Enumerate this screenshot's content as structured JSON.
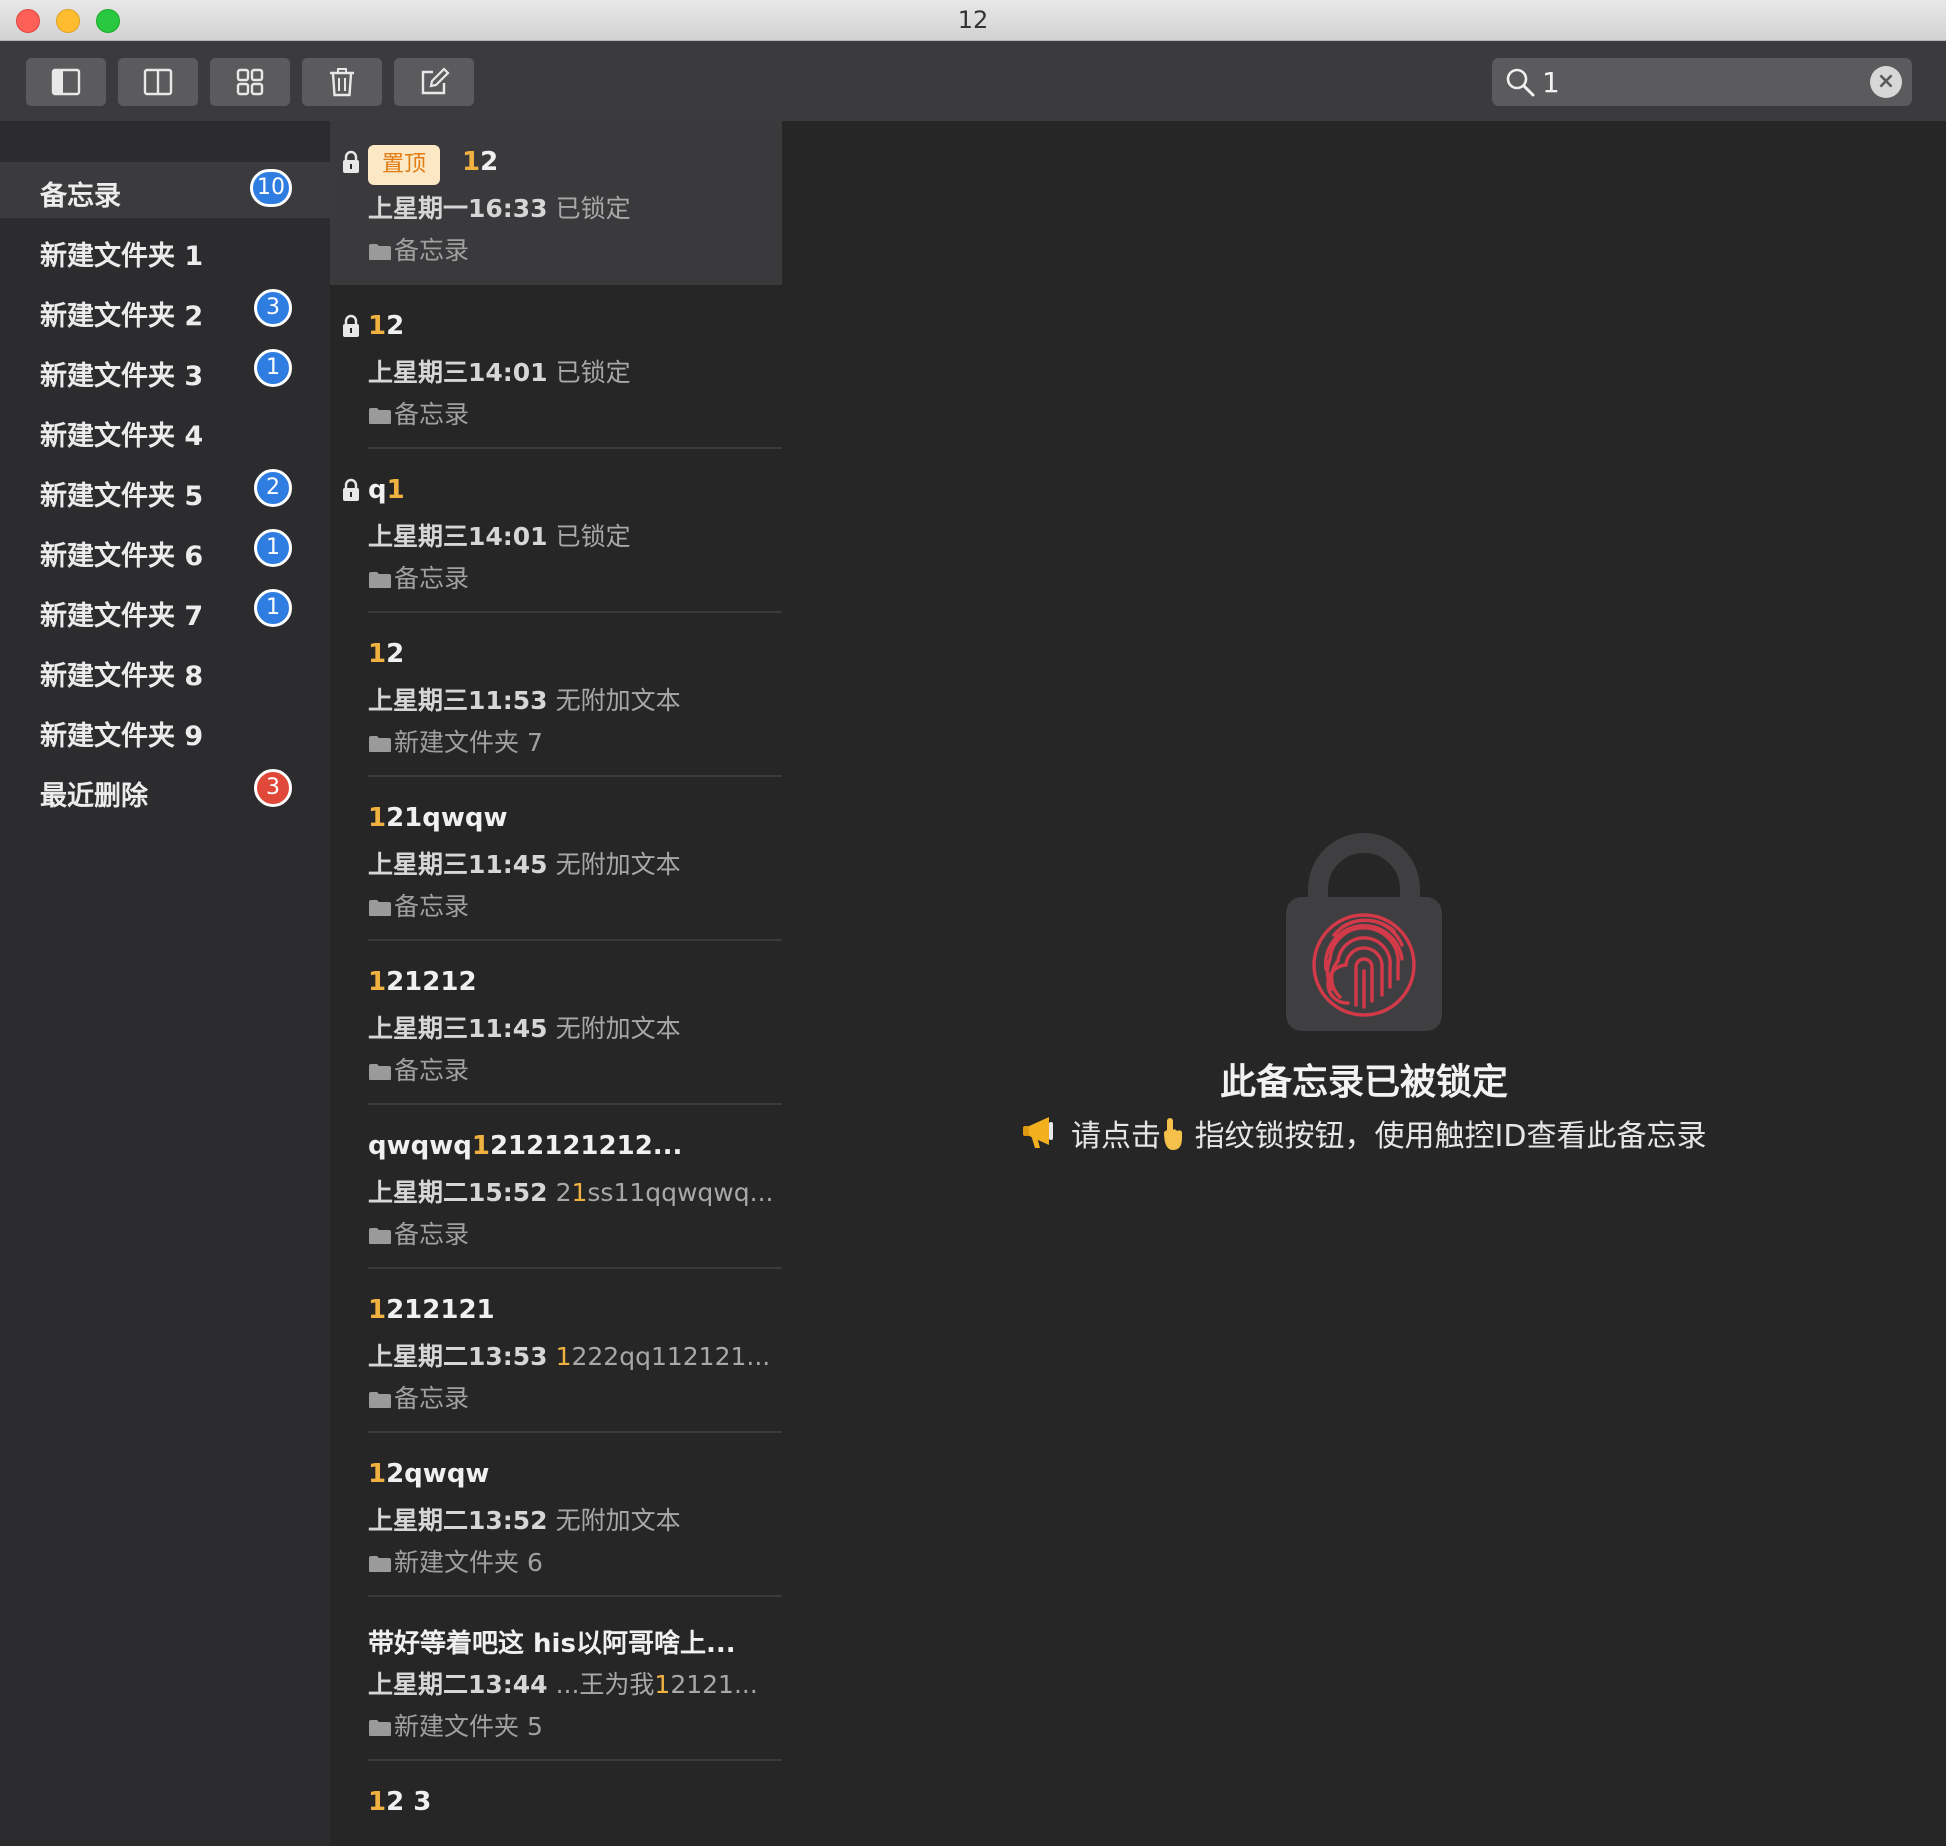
{
  "window": {
    "title": "12"
  },
  "toolbar": {
    "buttons": [
      {
        "name": "sidebar-toggle",
        "icon": "sidebar-icon"
      },
      {
        "name": "list-view",
        "icon": "columns-icon"
      },
      {
        "name": "gallery-view",
        "icon": "grid-icon"
      },
      {
        "name": "delete",
        "icon": "trash-icon"
      },
      {
        "name": "compose",
        "icon": "compose-icon"
      }
    ],
    "search": {
      "value": "1"
    }
  },
  "sidebar": {
    "items": [
      {
        "label": "备忘录",
        "count": "10",
        "selected": true
      },
      {
        "label": "新建文件夹 1",
        "count": ""
      },
      {
        "label": "新建文件夹 2",
        "count": "3"
      },
      {
        "label": "新建文件夹 3",
        "count": "1"
      },
      {
        "label": "新建文件夹 4",
        "count": ""
      },
      {
        "label": "新建文件夹 5",
        "count": "2"
      },
      {
        "label": "新建文件夹 6",
        "count": "1"
      },
      {
        "label": "新建文件夹 7",
        "count": "1"
      },
      {
        "label": "新建文件夹 8",
        "count": ""
      },
      {
        "label": "新建文件夹 9",
        "count": ""
      },
      {
        "label": "最近删除",
        "count": "3",
        "badge_color": "#e0483a"
      }
    ]
  },
  "notes": {
    "pin_label": "置顶",
    "items": [
      {
        "title_hl": "1",
        "title_rest": "2",
        "time": "上星期一16:33",
        "snippet": "已锁定",
        "folder": "备忘录",
        "locked": true,
        "pinned": true
      },
      {
        "title_hl": "1",
        "title_rest": "2",
        "time": "上星期三14:01",
        "snippet": "已锁定",
        "folder": "备忘录",
        "locked": true
      },
      {
        "title_pre": "q",
        "title_hl": "1",
        "title_rest": "",
        "time": "上星期三14:01",
        "snippet": "已锁定",
        "folder": "备忘录",
        "locked": true
      },
      {
        "title_hl": "1",
        "title_rest": "2",
        "time": "上星期三11:53",
        "snippet": "无附加文本",
        "folder": "新建文件夹 7"
      },
      {
        "title_hl": "1",
        "title_rest": "21qwqw",
        "time": "上星期三11:45",
        "snippet": "无附加文本",
        "folder": "备忘录"
      },
      {
        "title_hl": "1",
        "title_rest": "21212",
        "time": "上星期三11:45",
        "snippet": "无附加文本",
        "folder": "备忘录"
      },
      {
        "title_pre": "qwqwq",
        "title_hl": "1",
        "title_rest": "212121212...",
        "time": "上星期二15:52",
        "snippet_pre": "2",
        "snippet_hl": "1",
        "snippet": "ss11qqwqwq...",
        "folder": "备忘录"
      },
      {
        "title_hl": "1",
        "title_rest": "212121",
        "time": "上星期二13:53",
        "snippet_hl": "1",
        "snippet": "222qq112121...",
        "folder": "备忘录"
      },
      {
        "title_hl": "1",
        "title_rest": "2qwqw",
        "time": "上星期二13:52",
        "snippet": "无附加文本",
        "folder": "新建文件夹 6"
      },
      {
        "title_rest": "带好等着吧这 his以阿哥啥上...",
        "time": "上星期二13:44",
        "snippet_pre": "...王为我",
        "snippet_hl": "1",
        "snippet": "2121...",
        "folder": "新建文件夹 5"
      },
      {
        "title_hl": "1",
        "title_rest": "2 3",
        "time": "",
        "snippet": "",
        "folder": ""
      }
    ]
  },
  "detail": {
    "locked_title": "此备忘录已被锁定",
    "hint_part1": "请点击",
    "hint_part2": "指纹锁按钮，使用触控ID查看此备忘录",
    "fingerprint_color": "#d23a4a"
  }
}
